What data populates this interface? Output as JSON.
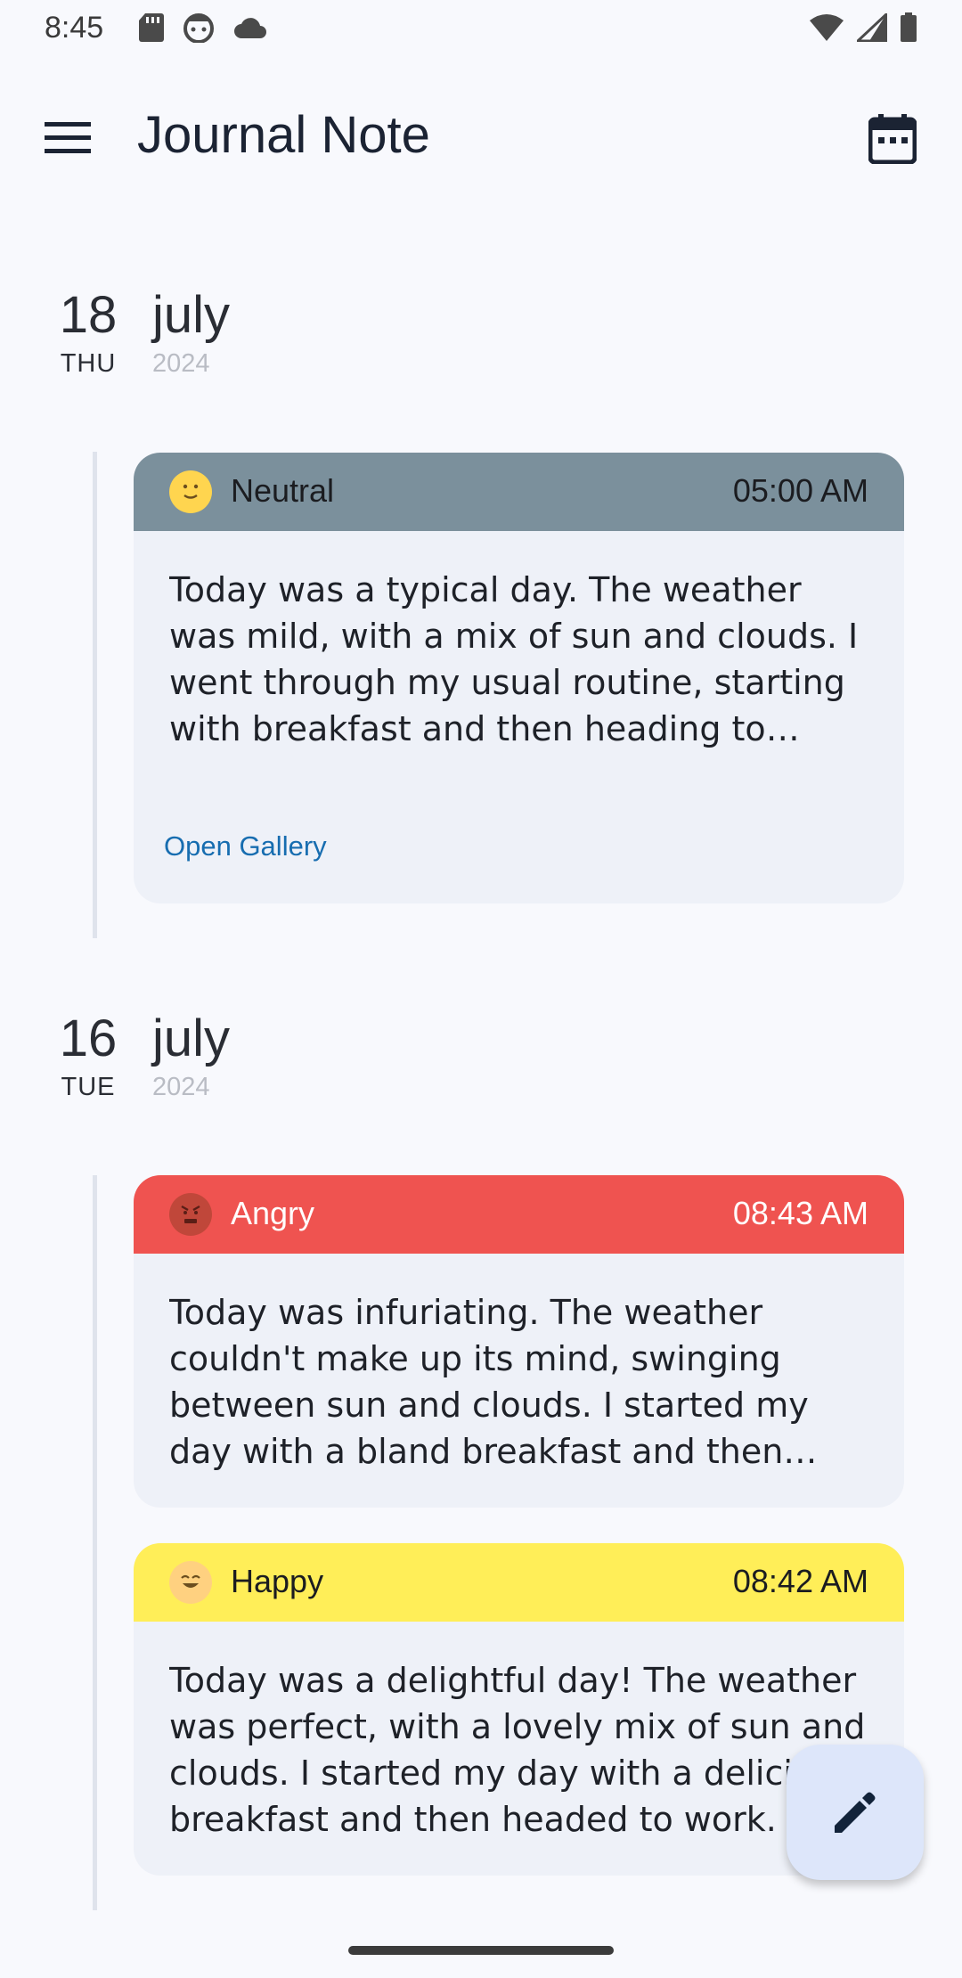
{
  "status_bar": {
    "time": "8:45"
  },
  "app_bar": {
    "title": "Journal Note"
  },
  "entries_groups": [
    {
      "day": "18",
      "weekday": "THU",
      "month": "july",
      "year": "2024",
      "entries": [
        {
          "mood": "Neutral",
          "time": "05:00 AM",
          "header_color": "#7b909c",
          "text_color": "#1b1c20",
          "text": "Today was a typical day. The weather was mild, with a mix of sun and clouds. I went through my usual routine, starting with breakfast and then heading to work.",
          "gallery_link": "Open Gallery"
        }
      ]
    },
    {
      "day": "16",
      "weekday": "TUE",
      "month": "july",
      "year": "2024",
      "entries": [
        {
          "mood": "Angry",
          "time": "08:43 AM",
          "header_color": "#ef5350",
          "text_color": "#ffffff",
          "text": "Today was infuriating. The weather couldn't make up its mind, swinging between sun and clouds. I started my day with a bland breakfast and then began work."
        },
        {
          "mood": "Happy",
          "time": "08:42 AM",
          "header_color": "#ffee58",
          "text_color": "#1b1c20",
          "text": "Today was a delightful day! The weather was perfect, with a lovely mix of sun and clouds. I started my day with a delicious breakfast and then headed to work."
        }
      ]
    }
  ],
  "fab": {
    "icon": "pencil-icon"
  }
}
